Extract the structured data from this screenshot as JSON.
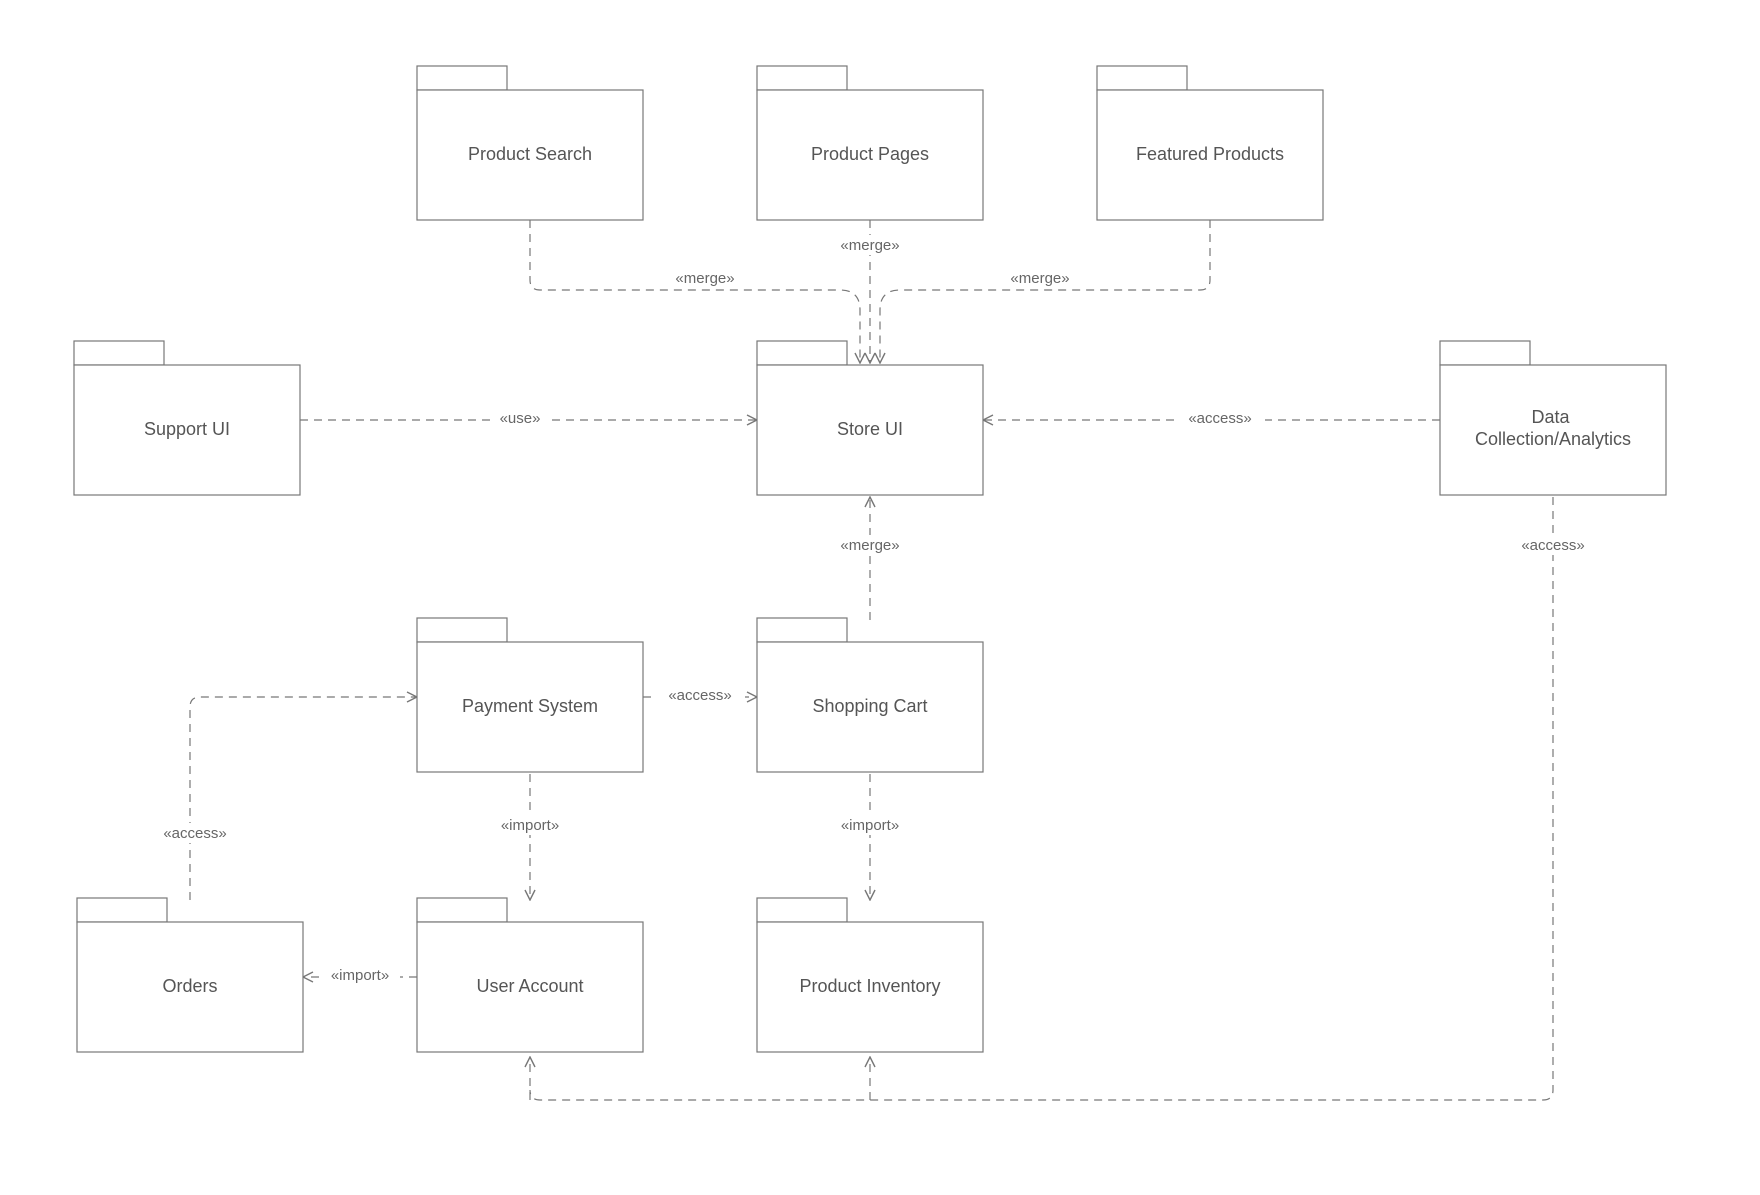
{
  "diagram": {
    "type": "uml-package-diagram",
    "packages": {
      "product_search": {
        "label": "Product Search"
      },
      "product_pages": {
        "label": "Product Pages"
      },
      "featured_products": {
        "label": "Featured Products"
      },
      "support_ui": {
        "label": "Support UI"
      },
      "store_ui": {
        "label": "Store UI"
      },
      "data_analytics": {
        "label": "Data\nCollection/Analytics"
      },
      "payment_system": {
        "label": "Payment System"
      },
      "shopping_cart": {
        "label": "Shopping Cart"
      },
      "orders": {
        "label": "Orders"
      },
      "user_account": {
        "label": "User Account"
      },
      "product_inventory": {
        "label": "Product Inventory"
      }
    },
    "relations": {
      "ps_merge": {
        "label": "«merge»",
        "from": "product_search",
        "to": "store_ui"
      },
      "pp_merge": {
        "label": "«merge»",
        "from": "product_pages",
        "to": "store_ui"
      },
      "fp_merge": {
        "label": "«merge»",
        "from": "featured_products",
        "to": "store_ui"
      },
      "support_use": {
        "label": "«use»",
        "from": "support_ui",
        "to": "store_ui"
      },
      "da_access1": {
        "label": "«access»",
        "from": "data_analytics",
        "to": "store_ui"
      },
      "sc_merge": {
        "label": "«merge»",
        "from": "shopping_cart",
        "to": "store_ui"
      },
      "pay_access": {
        "label": "«access»",
        "from": "payment_system",
        "to": "shopping_cart"
      },
      "orders_access": {
        "label": "«access»",
        "from": "orders",
        "to": "payment_system"
      },
      "pay_import": {
        "label": "«import»",
        "from": "payment_system",
        "to": "user_account"
      },
      "sc_import": {
        "label": "«import»",
        "from": "shopping_cart",
        "to": "product_inventory"
      },
      "ua_import": {
        "label": "«import»",
        "from": "user_account",
        "to": "orders"
      },
      "da_access2": {
        "label": "«access»",
        "from": "data_analytics",
        "to": "product_inventory"
      },
      "da_access3": {
        "label": "«access»",
        "from": "data_analytics",
        "to": "user_account"
      }
    }
  }
}
